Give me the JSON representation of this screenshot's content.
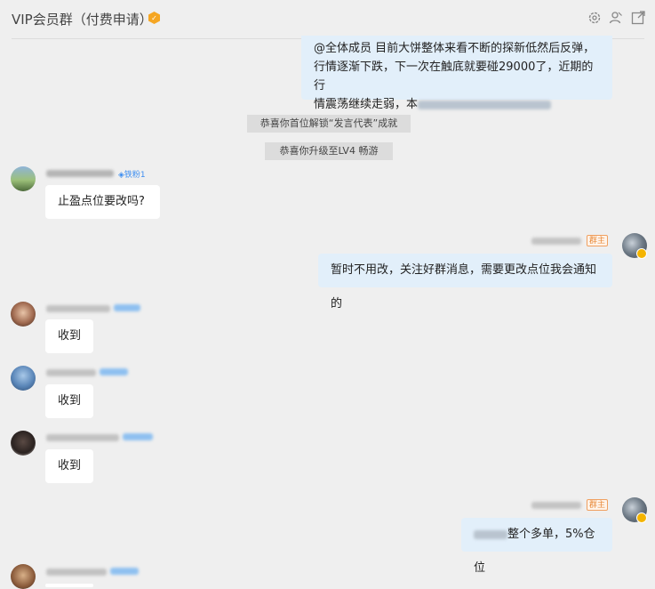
{
  "header": {
    "title": "VIP会员群（付费申请）",
    "icons": [
      "settings-icon",
      "members-icon",
      "popout-icon"
    ]
  },
  "messages": {
    "announcement": {
      "line1": "@全体成员   目前大饼整体来看不断的探新低然后反弹，",
      "line2": "行情逐渐下跌，下一次在触底就要碰29000了，近期的行",
      "line3": "情震荡继续走弱，本"
    },
    "notice1": "恭喜你首位解锁“发言代表”成就",
    "notice2": "恭喜你升级至LV4 畅游",
    "msg_q_badge": "◈铁粉1",
    "msg_q_text": "止盈点位要改吗?",
    "msg_owner_tag": "群主",
    "msg_owner_text": "暂时不用改，关注好群消息，需要更改点位我会通知的",
    "reply1": "收到",
    "reply2": "收到",
    "reply3": "收到",
    "msg_owner2_tag": "群主",
    "msg_owner2_text": "整个多单，5%仓位"
  },
  "colors": {
    "background": "#efefef",
    "my_bubble": "#e2effa",
    "owner_tag": "#e88a3a",
    "badge_blue": "#3d8ef0"
  }
}
